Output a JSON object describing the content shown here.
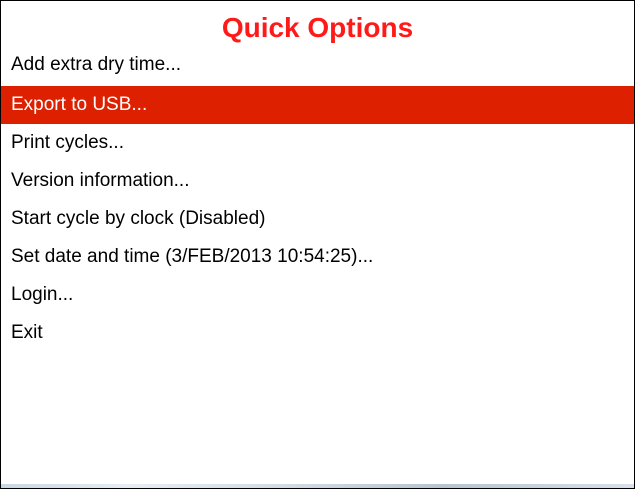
{
  "window": {
    "title": "Quick Options"
  },
  "menu": {
    "items": [
      {
        "label": "Add extra dry time..."
      },
      {
        "label": "Export to USB...",
        "selected": true
      },
      {
        "label": "Print cycles..."
      },
      {
        "label": "Version information..."
      },
      {
        "label": "Start cycle by clock (Disabled)"
      },
      {
        "label": "Set date and time (3/FEB/2013 10:54:25)..."
      },
      {
        "label": "Login..."
      },
      {
        "label": "Exit"
      }
    ]
  },
  "colors": {
    "title": "#ff1a1a",
    "selection": "#dd2000",
    "background": "#ffffff"
  }
}
